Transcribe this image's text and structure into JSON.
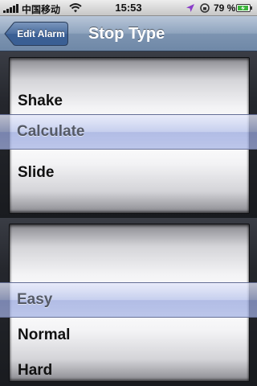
{
  "status_bar": {
    "carrier": "中国移动",
    "time": "15:53",
    "battery_percent": "79 %",
    "icons": [
      "signal-icon",
      "wifi-icon",
      "location-icon",
      "rotation-lock-icon",
      "battery-icon"
    ]
  },
  "nav": {
    "back_label": "Edit Alarm",
    "title": "Stop Type"
  },
  "picker_stop_type": {
    "rows_above": [
      "Shake"
    ],
    "selected": "Calculate",
    "rows_below": [
      "Slide"
    ]
  },
  "picker_difficulty": {
    "selected": "Easy",
    "rows_below": [
      "Normal",
      "Hard"
    ]
  },
  "colors": {
    "nav_bar": "#7d94b1",
    "selection_bar": "#b2bee8",
    "wheel": "#ffffff"
  }
}
